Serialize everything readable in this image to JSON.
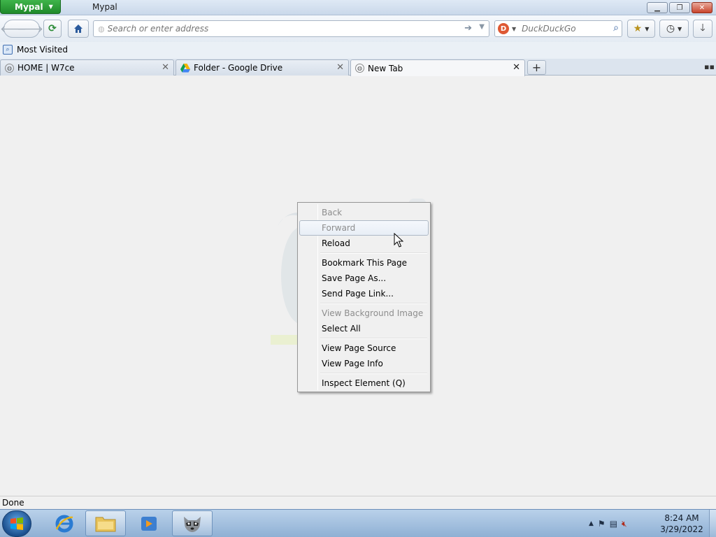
{
  "app": {
    "menu_label": "Mypal",
    "window_title": "Mypal"
  },
  "nav": {
    "url_placeholder": "Search or enter address",
    "search_placeholder": "DuckDuckGo"
  },
  "bookmarks_toolbar": {
    "most_visited": "Most Visited"
  },
  "tabs": [
    {
      "title": "HOME | W7ce",
      "active": false
    },
    {
      "title": "Folder - Google Drive",
      "active": false
    },
    {
      "title": "New Tab",
      "active": true
    }
  ],
  "context_menu": {
    "items": [
      {
        "label": "Back",
        "disabled": true
      },
      {
        "label": "Forward",
        "disabled": true,
        "highlighted": true
      },
      {
        "label": "Reload",
        "disabled": false
      },
      {
        "label": "Bookmark This Page",
        "disabled": false
      },
      {
        "label": "Save Page As...",
        "disabled": false
      },
      {
        "label": "Send Page Link...",
        "disabled": false
      },
      {
        "label": "View Background Image",
        "disabled": true
      },
      {
        "label": "Select All",
        "disabled": false
      },
      {
        "label": "View Page Source",
        "disabled": false
      },
      {
        "label": "View Page Info",
        "disabled": false
      },
      {
        "label": "Inspect Element (Q)",
        "disabled": false
      }
    ]
  },
  "status": {
    "text": "Done"
  },
  "taskbar": {
    "clock_time": "8:24 AM",
    "clock_date": "3/29/2022"
  },
  "colors": {
    "app_button": "#2a9a36",
    "accent": "#2b5a9c"
  }
}
